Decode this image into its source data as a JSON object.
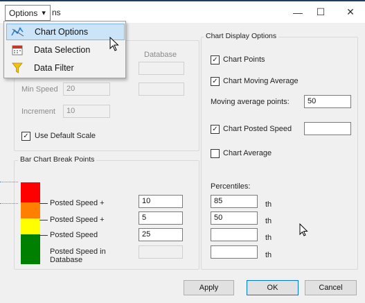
{
  "window": {
    "title_suffix": "ns",
    "minimize_glyph": "—",
    "maximize_glyph": "☐",
    "close_glyph": "✕"
  },
  "menu": {
    "button_label": "Options",
    "arrow_glyph": "▾",
    "items": [
      {
        "label": "Chart Options",
        "icon": "chart-options-icon",
        "highlighted": true
      },
      {
        "label": "Data Selection",
        "icon": "calendar-icon",
        "highlighted": false
      },
      {
        "label": "Data Filter",
        "icon": "funnel-icon",
        "highlighted": false
      }
    ]
  },
  "left_panel": {
    "database_label": "Database",
    "min_speed_label": "Min Speed",
    "min_speed_value": "20",
    "increment_label": "Increment",
    "increment_value": "10",
    "use_default_scale_label": "Use Default Scale",
    "use_default_scale_checked": true
  },
  "break_points": {
    "title": "Bar Chart Break Points",
    "rows": [
      {
        "label": "Posted Speed +",
        "value": "10",
        "color": "#ff0000"
      },
      {
        "label": "Posted Speed +",
        "value": "5",
        "color": "#ff8000"
      },
      {
        "label": "Posted Speed",
        "value": "25",
        "color": "#ffff00"
      },
      {
        "label": "Posted Speed in Database",
        "value": "",
        "color": "#008000"
      }
    ]
  },
  "display_options": {
    "title": "Chart Display Options",
    "chart_points_label": "Chart Points",
    "chart_points_checked": true,
    "chart_moving_average_label": "Chart Moving Average",
    "chart_moving_average_checked": true,
    "moving_average_points_label": "Moving average points:",
    "moving_average_points_value": "50",
    "chart_posted_speed_label": "Chart Posted Speed",
    "chart_posted_speed_checked": true,
    "chart_posted_speed_value": "",
    "chart_average_label": "Chart Average",
    "chart_average_checked": false,
    "percentiles_label": "Percentiles:",
    "percentiles": [
      {
        "value": "85",
        "suffix": "th"
      },
      {
        "value": "50",
        "suffix": "th"
      },
      {
        "value": "",
        "suffix": "th"
      },
      {
        "value": "",
        "suffix": "th"
      }
    ]
  },
  "buttons": {
    "apply": "Apply",
    "ok": "OK",
    "cancel": "Cancel"
  },
  "check_glyph": "✓"
}
